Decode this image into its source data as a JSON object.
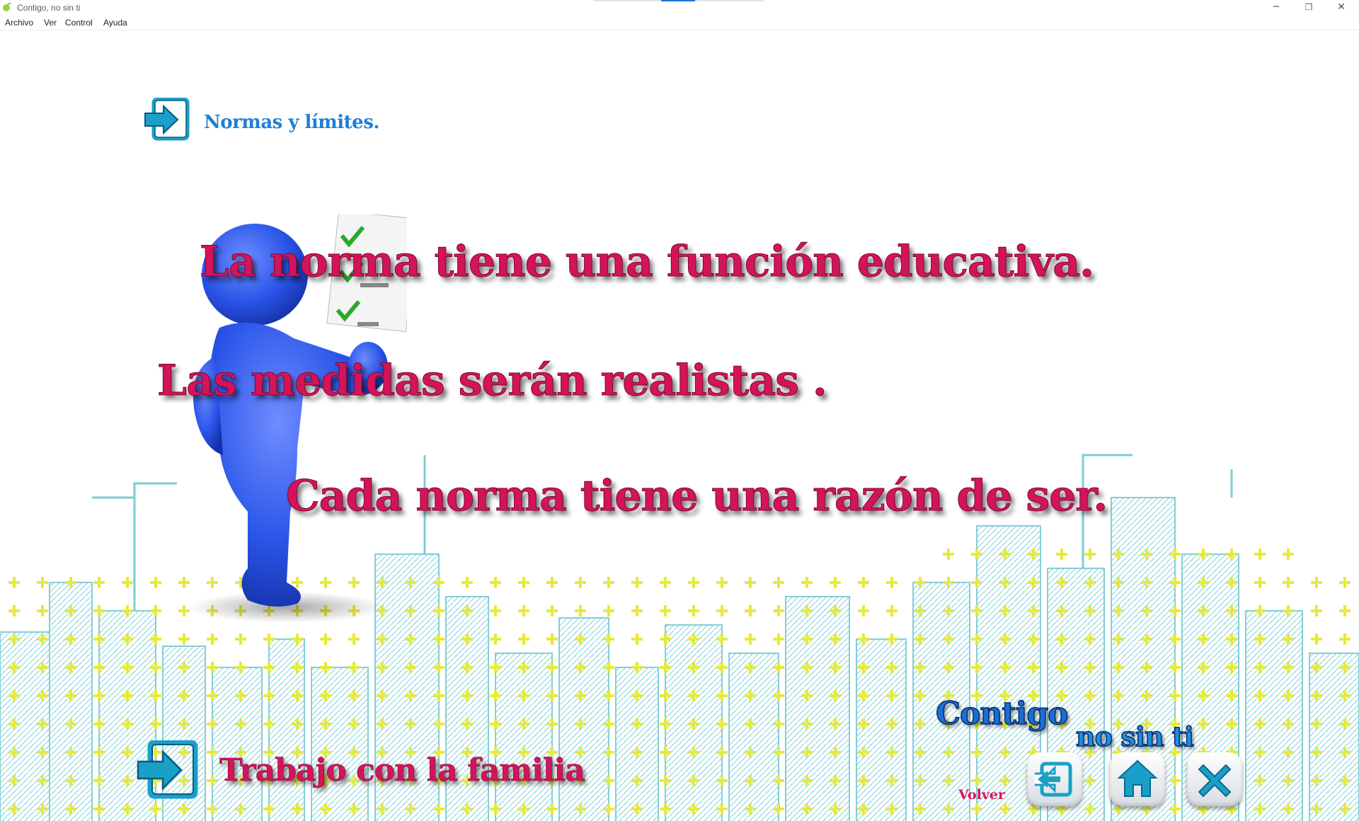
{
  "window": {
    "title": "Contigo, no sin ti",
    "minimize_glyph": "─",
    "restore_glyph": "❐",
    "close_glyph": "✕"
  },
  "menu": [
    "Archivo",
    "Ver",
    "Control",
    "Ayuda"
  ],
  "slide": {
    "section_title": "Normas y límites.",
    "lines": [
      "La norma tiene una función educativa.",
      "Las medidas serán realistas .",
      "Cada norma tiene una razón de ser."
    ],
    "family_link": "Trabajo con la familia"
  },
  "logo": {
    "line1": "Contigo",
    "line2": "no sin ti"
  },
  "nav": {
    "back_label": "Volver",
    "buttons": [
      "back-arrow-icon",
      "home-icon",
      "close-x-icon"
    ]
  },
  "colors": {
    "accent_blue": "#1e7fd6",
    "text_magenta": "#d4145a",
    "icon_teal": "#1aa0c8",
    "figure_blue": "#2a55e8",
    "cross_yellow": "#e6ea3a"
  }
}
